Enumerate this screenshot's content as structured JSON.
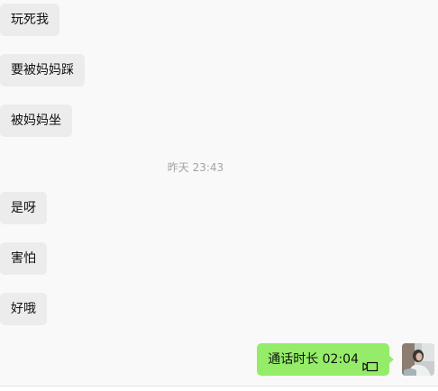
{
  "messages_incoming": [
    {
      "text": "玩死我"
    },
    {
      "text": "要被妈妈踩"
    },
    {
      "text": "被妈妈坐"
    },
    {
      "text": "是呀"
    },
    {
      "text": "害怕"
    },
    {
      "text": "好哦"
    }
  ],
  "timestamp": "昨天 23:43",
  "message_outgoing": {
    "text": "通话时长 02:04",
    "icon": "video-call-icon"
  },
  "colors": {
    "incoming_bubble": "#ececec",
    "outgoing_bubble": "#95ec69",
    "background": "#f9f9f9",
    "timestamp_text": "#a3a3a3"
  }
}
